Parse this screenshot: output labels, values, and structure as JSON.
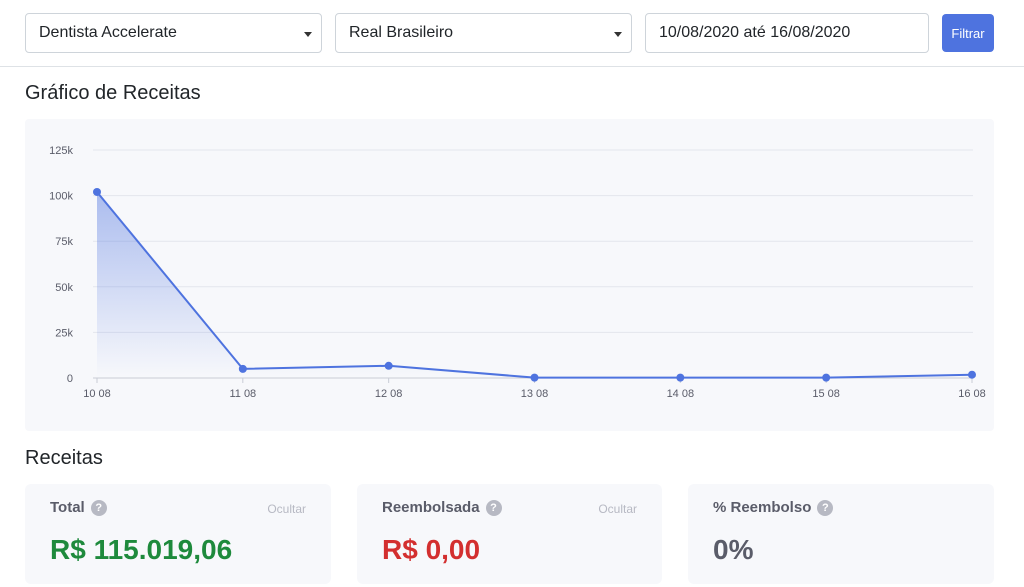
{
  "filters": {
    "clinic": "Dentista Accelerate",
    "currency": "Real Brasileiro",
    "date_range": "10/08/2020 até 16/08/2020",
    "filter_button": "Filtrar"
  },
  "chart_section_title": "Gráfico de Receitas",
  "chart_data": {
    "type": "area",
    "title": "",
    "xlabel": "",
    "ylabel": "",
    "categories": [
      "10 08",
      "11 08",
      "12 08",
      "13 08",
      "14 08",
      "15 08",
      "16 08"
    ],
    "values": [
      102000,
      5000,
      6700,
      200,
      200,
      200,
      1800
    ],
    "y_ticks": [
      "0",
      "25k",
      "50k",
      "75k",
      "100k",
      "125k"
    ],
    "ylim": [
      0,
      125000
    ],
    "grid": true,
    "colors": {
      "line": "#4e73df",
      "fill": "#4e73df"
    }
  },
  "revenue_section_title": "Receitas",
  "cards": [
    {
      "title": "Total",
      "hide_label": "Ocultar",
      "value": "R$ 115.019,06",
      "color": "#1e8a3c"
    },
    {
      "title": "Reembolsada",
      "hide_label": "Ocultar",
      "value": "R$ 0,00",
      "color": "#d32f2f"
    },
    {
      "title": "% Reembolso",
      "value": "0%",
      "color": "#5a5c69"
    }
  ],
  "icons": {
    "help": "question-circle-icon",
    "caret": "caret-down-icon"
  }
}
